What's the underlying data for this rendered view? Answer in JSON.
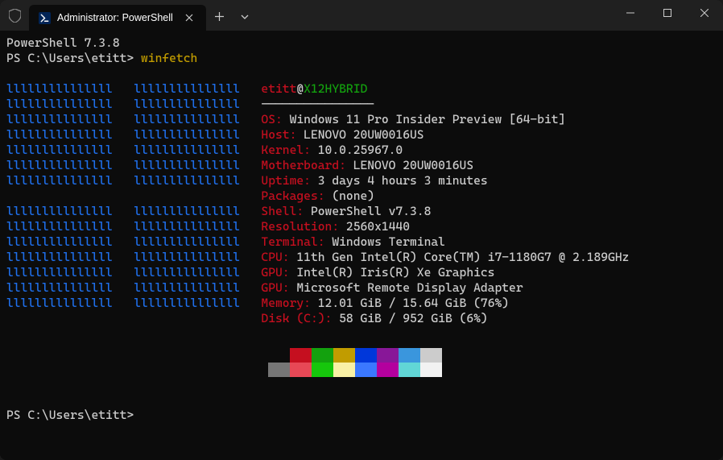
{
  "window": {
    "tab_title": "Administrator: PowerShell"
  },
  "terminal": {
    "version_line": "PowerShell 7.3.8",
    "prompt1_prefix": "PS C:\\Users\\etitt> ",
    "prompt1_cmd": "winfetch",
    "prompt2": "PS C:\\Users\\etitt>",
    "header_user": "etitt",
    "header_sep": "@",
    "header_host": "X12HYBRID",
    "divider": "----------------",
    "info": [
      {
        "label": "OS",
        "value": "Windows 11 Pro Insider Preview [64-bit]"
      },
      {
        "label": "Host",
        "value": "LENOVO 20UW0016US"
      },
      {
        "label": "Kernel",
        "value": "10.0.25967.0"
      },
      {
        "label": "Motherboard",
        "value": "LENOVO 20UW0016US"
      },
      {
        "label": "Uptime",
        "value": "3 days 4 hours 3 minutes"
      },
      {
        "label": "Packages",
        "value": "(none)"
      },
      {
        "label": "Shell",
        "value": "PowerShell v7.3.8"
      },
      {
        "label": "Resolution",
        "value": "2560x1440"
      },
      {
        "label": "Terminal",
        "value": "Windows Terminal"
      },
      {
        "label": "CPU",
        "value": "11th Gen Intel(R) Core(TM) i7-1180G7 @ 2.189GHz"
      },
      {
        "label": "GPU",
        "value": "Intel(R) Iris(R) Xe Graphics"
      },
      {
        "label": "GPU",
        "value": "Microsoft Remote Display Adapter"
      },
      {
        "label": "Memory",
        "value": "12.01 GiB / 15.64 GiB (76%)"
      },
      {
        "label": "Disk (C:)",
        "value": "58 GiB / 952 GiB (6%)"
      }
    ],
    "logo_lines": [
      "lllllllllllllll   lllllllllllllll",
      "lllllllllllllll   lllllllllllllll",
      "lllllllllllllll   lllllllllllllll",
      "lllllllllllllll   lllllllllllllll",
      "lllllllllllllll   lllllllllllllll",
      "lllllllllllllll   lllllllllllllll",
      "lllllllllllllll   lllllllllllllll",
      "                                 ",
      "lllllllllllllll   lllllllllllllll",
      "lllllllllllllll   lllllllllllllll",
      "lllllllllllllll   lllllllllllllll",
      "lllllllllllllll   lllllllllllllll",
      "lllllllllllllll   lllllllllllllll",
      "lllllllllllllll   lllllllllllllll",
      "lllllllllllllll   lllllllllllllll"
    ],
    "colors_row1": [
      "#0c0c0c",
      "#c50f1f",
      "#13a10e",
      "#c19c00",
      "#0037da",
      "#881798",
      "#3a96dd",
      "#cccccc"
    ],
    "colors_row2": [
      "#767676",
      "#e74856",
      "#16c60c",
      "#f9f1a5",
      "#3b78ff",
      "#b4009e",
      "#61d6d6",
      "#f2f2f2"
    ]
  }
}
